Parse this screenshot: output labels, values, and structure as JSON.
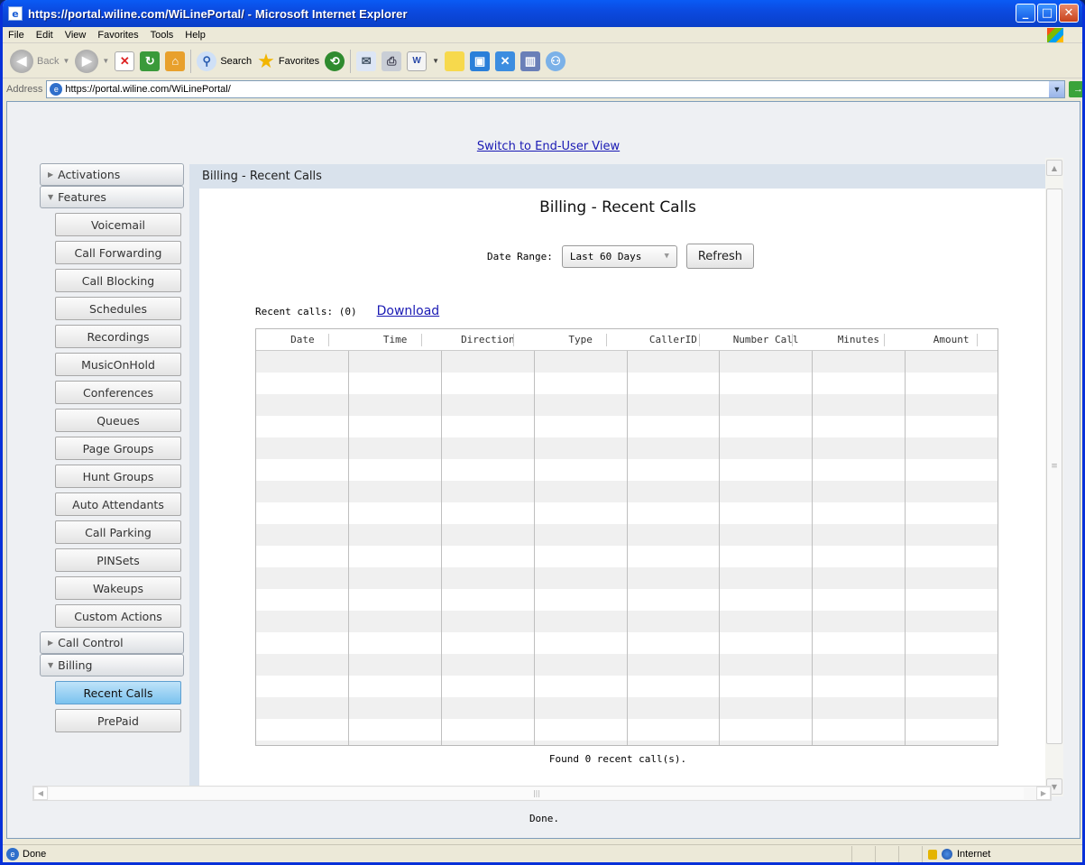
{
  "window": {
    "title": "https://portal.wiline.com/WiLinePortal/ - Microsoft Internet Explorer"
  },
  "menu": [
    "File",
    "Edit",
    "View",
    "Favorites",
    "Tools",
    "Help"
  ],
  "toolbar": {
    "back_label": "Back",
    "search_label": "Search",
    "favorites_label": "Favorites"
  },
  "address": {
    "label": "Address",
    "url": "https://portal.wiline.com/WiLinePortal/",
    "go_label": "Go"
  },
  "page": {
    "switch_link": "Switch to End-User View",
    "breadcrumb": "Billing - Recent Calls",
    "title": "Billing - Recent Calls",
    "date_range_label": "Date Range:",
    "date_range_value": "Last 60 Days",
    "refresh_label": "Refresh",
    "recent_calls_label": "Recent calls: (0)",
    "download_label": "Download",
    "found_text": "Found 0 recent call(s).",
    "done_text": "Done."
  },
  "nav": {
    "activations": "Activations",
    "features": "Features",
    "feature_items": [
      "Voicemail",
      "Call Forwarding",
      "Call Blocking",
      "Schedules",
      "Recordings",
      "MusicOnHold",
      "Conferences",
      "Queues",
      "Page Groups",
      "Hunt Groups",
      "Auto Attendants",
      "Call Parking",
      "PINSets",
      "Wakeups",
      "Custom Actions"
    ],
    "call_control": "Call Control",
    "billing": "Billing",
    "billing_items": [
      "Recent Calls",
      "PrePaid"
    ],
    "active_item": "Recent Calls"
  },
  "table": {
    "columns": [
      "Date",
      "Time",
      "Direction",
      "Type",
      "CallerID",
      "Number Call",
      "Minutes",
      "Amount"
    ],
    "rows": []
  },
  "status": {
    "text": "Done",
    "zone": "Internet"
  },
  "colors": {
    "title_bar": "#0a4ae0",
    "link": "#1a1ab4",
    "active_nav": "#7ac2ee",
    "pane_header": "#d9e2ec"
  }
}
